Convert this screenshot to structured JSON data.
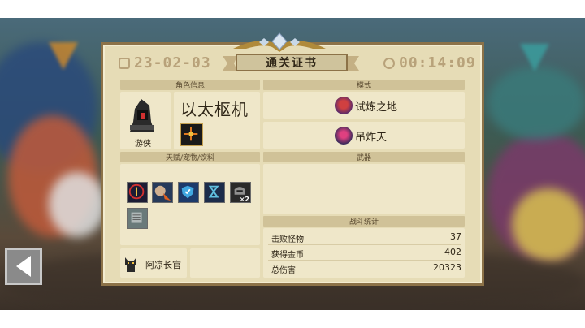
{
  "certificate": {
    "date": "23-02-03",
    "title": "通关证书",
    "time": "00:14:09"
  },
  "sections": {
    "character_info": "角色信息",
    "mode": "模式",
    "talents_pets_drinks": "天赋/宠物/饮料",
    "weapons": "武器",
    "battle_stats": "战斗统计"
  },
  "character": {
    "name": "以太枢机",
    "class": "游侠"
  },
  "modes": [
    {
      "label": "试炼之地",
      "icon": "trial-mode-icon"
    },
    {
      "label": "吊炸天",
      "icon": "badass-mode-icon"
    }
  ],
  "talents": [
    {
      "icon": "red-circle-talent-icon"
    },
    {
      "icon": "fire-beast-talent-icon"
    },
    {
      "icon": "shield-talent-icon"
    },
    {
      "icon": "hourglass-talent-icon"
    },
    {
      "icon": "helmet-talent-icon",
      "count": "×2"
    },
    {
      "icon": "scroll-talent-icon"
    }
  ],
  "pet": {
    "name": "阿凉长官",
    "icon": "cat-pet-icon"
  },
  "stats": [
    {
      "label": "击败怪物",
      "value": "37"
    },
    {
      "label": "获得金币",
      "value": "402"
    },
    {
      "label": "总伤害",
      "value": "20323"
    }
  ],
  "colors": {
    "parchment": "#e6dcb6",
    "border": "#8c7248",
    "header": "#d0c298",
    "muted_text": "#b8a27a"
  }
}
